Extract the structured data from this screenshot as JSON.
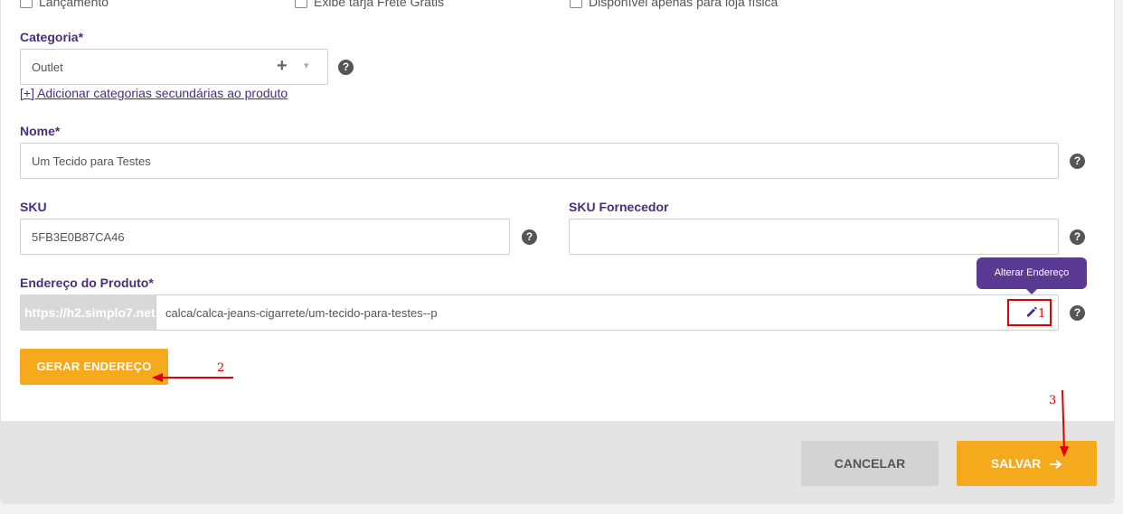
{
  "checkboxes": [
    {
      "label": "Lançamento"
    },
    {
      "label": "Exibe tarja Frete Grátis"
    },
    {
      "label": "Disponível apenas para loja física"
    }
  ],
  "categoria": {
    "label": "Categoria*",
    "value": "Outlet",
    "add_icon": "+",
    "dropdown_icon": "▾",
    "secondary_link": "[+] Adicionar categorias secundárias ao produto"
  },
  "nome": {
    "label": "Nome*",
    "value": "Um Tecido para Testes"
  },
  "sku": {
    "label": "SKU",
    "value": "5FB3E0B87CA46"
  },
  "sku_fornecedor": {
    "label": "SKU Fornecedor",
    "value": ""
  },
  "endereco": {
    "label": "Endereço do Produto*",
    "prefix": "https://h2.simplo7.net",
    "value": "calca/calca-jeans-cigarrete/um-tecido-para-testes--p",
    "tooltip": "Alterar Endereço"
  },
  "help_icon": "?",
  "buttons": {
    "gerar": "GERAR ENDEREÇO",
    "cancelar": "CANCELAR",
    "salvar": "SALVAR"
  },
  "annotations": {
    "n1": "1",
    "n2": "2",
    "n3": "3"
  },
  "colors": {
    "accent": "#f5a91c",
    "purple": "#4a2d7f",
    "annotation": "#e00000"
  }
}
